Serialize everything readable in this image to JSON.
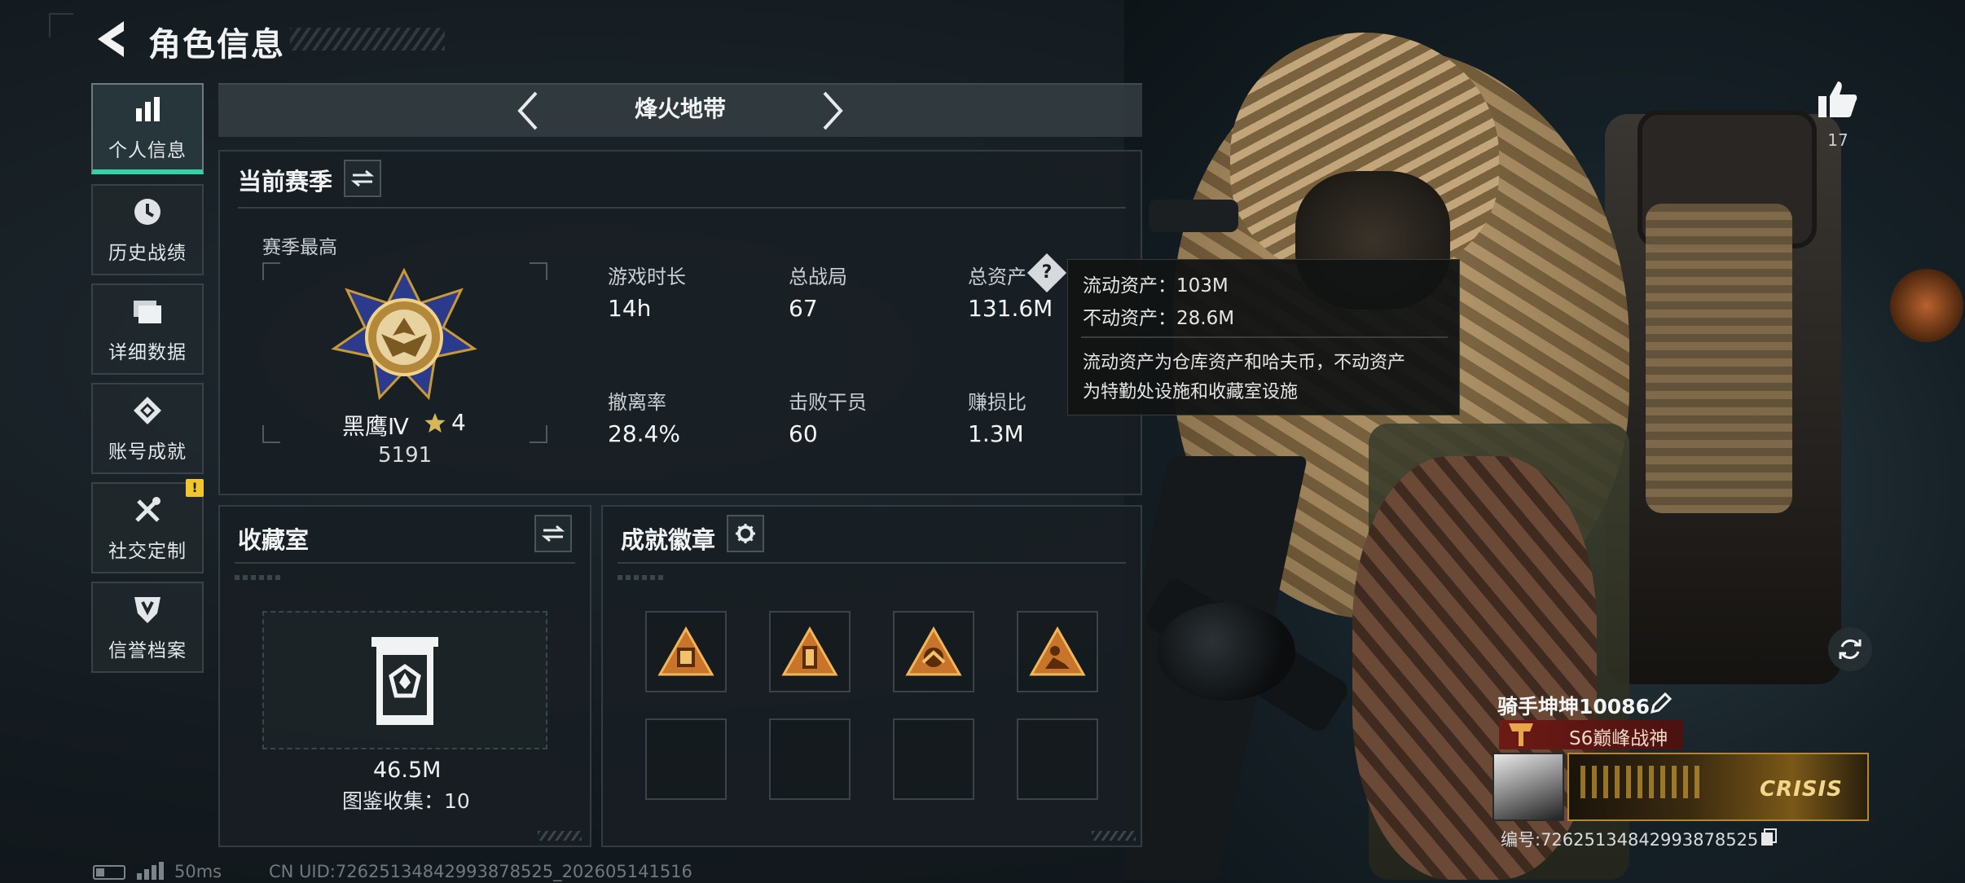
{
  "header": {
    "title": "角色信息",
    "back_icon": "back-arrow-icon"
  },
  "sidebar": {
    "items": [
      {
        "label": "个人信息",
        "icon": "bar-chart-icon",
        "active": true
      },
      {
        "label": "历史战绩",
        "icon": "clock-icon",
        "active": false
      },
      {
        "label": "详细数据",
        "icon": "folder-icon",
        "active": false
      },
      {
        "label": "账号成就",
        "icon": "achievement-icon",
        "active": false
      },
      {
        "label": "社交定制",
        "icon": "tools-icon",
        "active": false,
        "badge": "!"
      },
      {
        "label": "信誉档案",
        "icon": "shield-icon",
        "active": false
      }
    ]
  },
  "mode_switcher": {
    "title": "烽火地带"
  },
  "season": {
    "title": "当前赛季",
    "best_label": "赛季最高",
    "rank_name": "黑鹰Ⅳ",
    "rank_stars": "4",
    "rank_points": "5191",
    "stats": [
      {
        "label": "游戏时长",
        "value": "14h"
      },
      {
        "label": "总战局",
        "value": "67"
      },
      {
        "label": "总资产",
        "value": "131.6M"
      },
      {
        "label": "撤离率",
        "value": "28.4%"
      },
      {
        "label": "击败干员",
        "value": "60"
      },
      {
        "label": "赚损比",
        "value": "1.3M"
      }
    ]
  },
  "tooltip": {
    "line1": "流动资产：103M",
    "line2": "不动资产：28.6M",
    "desc1": "流动资产为仓库资产和哈夫币，不动资产",
    "desc2": "为特勤处设施和收藏室设施"
  },
  "collection": {
    "title": "收藏室",
    "value": "46.5M",
    "catalog": "图鉴收集：10"
  },
  "achievements": {
    "title": "成就徽章"
  },
  "profile": {
    "likes": "17",
    "player_name": "骑手坤坤10086",
    "rank_tag": "S6巅峰战神",
    "banner_text": "CRISIS",
    "serial": "编号:7262513484299387852​5"
  },
  "status_bar": {
    "ping": "50ms",
    "uid": "CN UID:7262513484299387852​5_202605141516"
  },
  "colors": {
    "accent": "#36d1a6",
    "warning": "#f0c531",
    "rank_red": "#6e1a16",
    "gold": "#c89a36"
  }
}
